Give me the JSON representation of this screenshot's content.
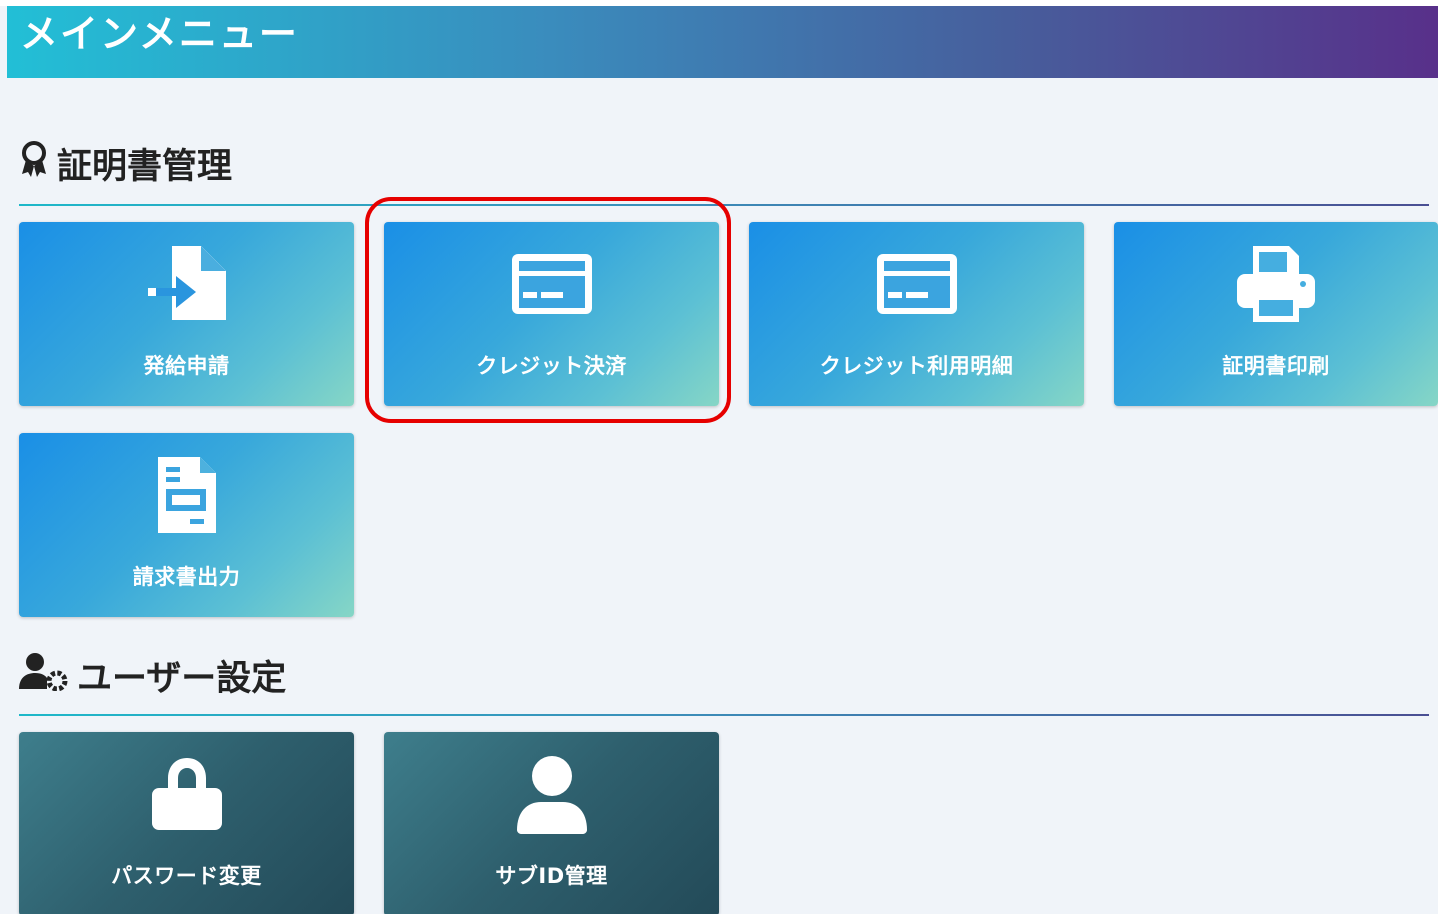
{
  "header": {
    "title": "メインメニュー"
  },
  "sections": [
    {
      "title": "証明書管理",
      "icon": "award-icon",
      "tiles": [
        {
          "label": "発給申請",
          "icon": "file-import-icon"
        },
        {
          "label": "クレジット決済",
          "icon": "credit-card-icon",
          "highlighted": true
        },
        {
          "label": "クレジット利用明細",
          "icon": "credit-card-icon"
        },
        {
          "label": "証明書印刷",
          "icon": "printer-icon"
        },
        {
          "label": "請求書出力",
          "icon": "invoice-document-icon"
        }
      ]
    },
    {
      "title": "ユーザー設定",
      "icon": "user-gear-icon",
      "tiles": [
        {
          "label": "パスワード変更",
          "icon": "lock-icon"
        },
        {
          "label": "サブID管理",
          "icon": "user-icon"
        }
      ]
    }
  ],
  "colors": {
    "header_gradient_start": "#22bfd6",
    "header_gradient_end": "#58308a",
    "tile_blue_start": "#1a8fe6",
    "tile_blue_end": "#86d6c6",
    "tile_dark_start": "#3e7e8c",
    "tile_dark_end": "#234a58",
    "highlight": "#e60000",
    "page_background": "#f0f4f9"
  }
}
